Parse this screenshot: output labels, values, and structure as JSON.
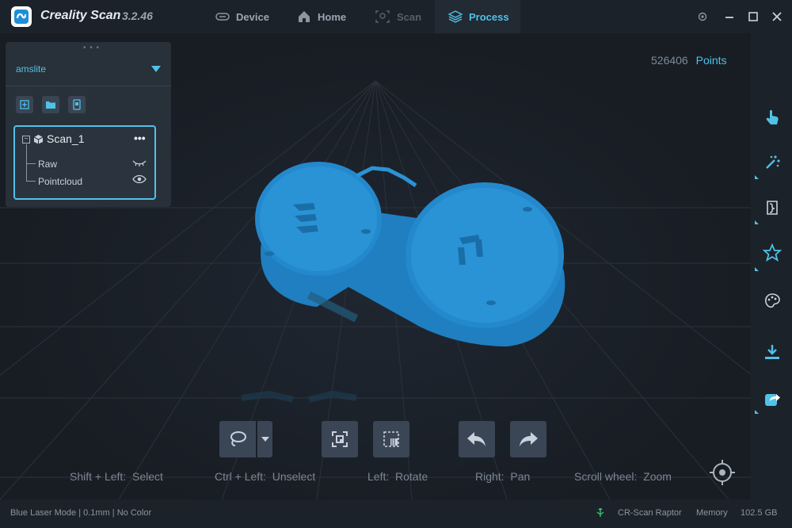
{
  "app": {
    "name": "Creality Scan",
    "version": "3.2.46"
  },
  "nav": {
    "tabs": [
      {
        "label": "Device",
        "icon": "device-icon",
        "state": "normal"
      },
      {
        "label": "Home",
        "icon": "home-icon",
        "state": "normal"
      },
      {
        "label": "Scan",
        "icon": "scan-icon",
        "state": "disabled"
      },
      {
        "label": "Process",
        "icon": "layers-icon",
        "state": "active"
      }
    ]
  },
  "window_controls": [
    "settings-icon",
    "minimize-icon",
    "maximize-icon",
    "close-icon"
  ],
  "scene_panel": {
    "project": "amslite",
    "tools": [
      "add-file-icon",
      "open-folder-icon",
      "document-icon"
    ],
    "tree": {
      "root": "Scan_1",
      "more": "•••",
      "children": [
        {
          "label": "Raw",
          "visibility": "hidden"
        },
        {
          "label": "Pointcloud",
          "visibility": "visible"
        }
      ]
    }
  },
  "viewport": {
    "points_value": "526406",
    "points_unit": "Points"
  },
  "right_toolbar": [
    "touch-select-icon",
    "magic-wand-icon",
    "mesh-icon",
    "star-model-icon",
    "texture-palette-icon",
    "export-download-icon",
    "share-icon"
  ],
  "bottom_tools": [
    "lasso-select-icon",
    "invert-select-icon",
    "delete-selection-icon",
    "undo-icon",
    "redo-icon"
  ],
  "hints": [
    "Shift + Left:  Select",
    "Ctrl + Left:  Unselect",
    "Left:  Rotate",
    "Right:  Pan",
    "Scroll wheel:  Zoom"
  ],
  "status": {
    "mode": "Blue Laser Mode  |  0.1mm  |  No Color",
    "device": "CR-Scan Raptor",
    "memory_label": "Memory",
    "memory_value": "102.5 GB"
  },
  "colors": {
    "accent": "#4fc2e8",
    "model": "#1f7fc0",
    "background": "#1a1f26"
  }
}
